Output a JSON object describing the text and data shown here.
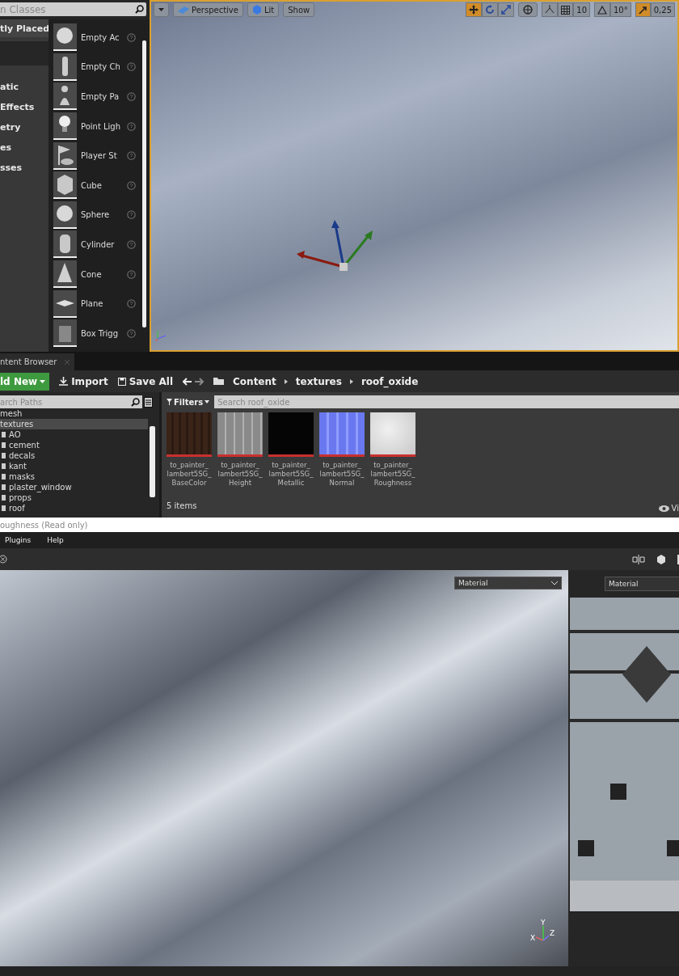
{
  "place_panel": {
    "search_placeholder": "n Classes",
    "categories": [
      {
        "label": "tly Placed",
        "selected": true
      },
      {
        "label": "atic",
        "selected": false
      },
      {
        "label": "Effects",
        "selected": false
      },
      {
        "label": "etry",
        "selected": false
      },
      {
        "label": "es",
        "selected": false
      },
      {
        "label": "sses",
        "selected": false
      }
    ],
    "items": [
      {
        "label": "Empty Ac",
        "kind": "sphere"
      },
      {
        "label": "Empty Ch",
        "kind": "figure"
      },
      {
        "label": "Empty Pa",
        "kind": "pawn"
      },
      {
        "label": "Point Ligh",
        "kind": "bulb"
      },
      {
        "label": "Player St",
        "kind": "flag"
      },
      {
        "label": "Cube",
        "kind": "cube"
      },
      {
        "label": "Sphere",
        "kind": "sphere"
      },
      {
        "label": "Cylinder",
        "kind": "cylinder"
      },
      {
        "label": "Cone",
        "kind": "cone"
      },
      {
        "label": "Plane",
        "kind": "plane"
      },
      {
        "label": "Box Trigg",
        "kind": "box"
      }
    ]
  },
  "viewport": {
    "view_menu": [
      {
        "label": "Perspective",
        "kind": "perspective"
      },
      {
        "label": "Lit",
        "kind": "lit"
      },
      {
        "label": "Show",
        "kind": "plain"
      }
    ],
    "transform_modes": [
      {
        "kind": "move",
        "selected": true
      },
      {
        "kind": "rotate",
        "selected": false
      },
      {
        "kind": "scale",
        "selected": false
      }
    ],
    "grid_snap": "10",
    "rotation_snap": "10°",
    "scale_snap": "0,25",
    "scale_snap_on": true
  },
  "content_browser": {
    "tab": "ntent Browser",
    "add_new": "ld New",
    "import": "Import",
    "save_all": "Save All",
    "breadcrumb": [
      "Content",
      "textures",
      "roof_oxide"
    ],
    "paths_placeholder": "arch Paths",
    "tree": [
      {
        "label": "mesh",
        "selected": false
      },
      {
        "label": "textures",
        "selected": true,
        "children": [
          {
            "label": "AO",
            "selected": false
          },
          {
            "label": "cement",
            "selected": false
          },
          {
            "label": "decals",
            "selected": false
          },
          {
            "label": "kant",
            "selected": false
          },
          {
            "label": "masks",
            "selected": false
          },
          {
            "label": "plaster_window",
            "selected": false
          },
          {
            "label": "props",
            "selected": false
          },
          {
            "label": "roof",
            "selected": false
          }
        ]
      }
    ],
    "filters": "Filters",
    "search_placeholder": "Search roof_oxide",
    "assets": [
      {
        "name": "to_painter_lambert5SG_BaseColor",
        "kind": "basecolor"
      },
      {
        "name": "to_painter_lambert5SG_Height",
        "kind": "height"
      },
      {
        "name": "to_painter_lambert5SG_Metallic",
        "kind": "metallic"
      },
      {
        "name": "to_painter_lambert5SG_Normal",
        "kind": "normal"
      },
      {
        "name": "to_painter_lambert5SG_Roughness",
        "kind": "roughness"
      }
    ],
    "count": "5 items",
    "view_options": "Vi"
  },
  "status_bar": "oughness (Read only)",
  "menu": [
    "Plugins",
    "Help"
  ],
  "material_viewport": {
    "material_select": "Material",
    "axes": [
      "X",
      "Y",
      "Z"
    ]
  },
  "uv_panel": {
    "material_select": "Material"
  }
}
